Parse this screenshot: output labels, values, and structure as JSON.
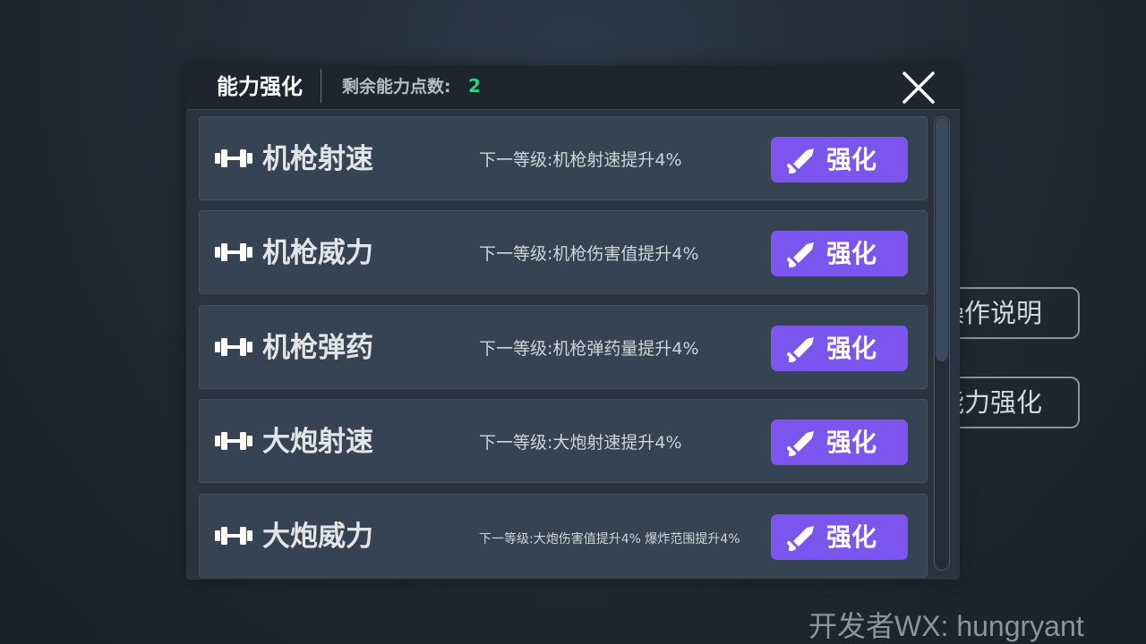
{
  "side_menu": {
    "help_label": "操作说明",
    "upgrade_label": "能力强化"
  },
  "watermark": "开发者WX: hungryant",
  "dialog": {
    "title": "能力强化",
    "points_label": "剩余能力点数:",
    "points_value": "2",
    "close_icon": "close-icon",
    "upgrades": [
      {
        "name": "机枪射速",
        "desc": "下一等级:机枪射速提升4%",
        "button": "强化",
        "icon": "dumbbell-icon"
      },
      {
        "name": "机枪威力",
        "desc": "下一等级:机枪伤害值提升4%",
        "button": "强化",
        "icon": "dumbbell-icon"
      },
      {
        "name": "机枪弹药",
        "desc": "下一等级:机枪弹药量提升4%",
        "button": "强化",
        "icon": "dumbbell-icon"
      },
      {
        "name": "大炮射速",
        "desc": "下一等级:大炮射速提升4%",
        "button": "强化",
        "icon": "dumbbell-icon"
      },
      {
        "name": "大炮威力",
        "desc": "下一等级:大炮伤害值提升4% 爆炸范围提升4%",
        "button": "强化",
        "icon": "dumbbell-icon"
      }
    ]
  },
  "colors": {
    "accent": "#7b55ee",
    "points": "#2dd47a",
    "panel": "#2a3440",
    "row": "#354352"
  }
}
